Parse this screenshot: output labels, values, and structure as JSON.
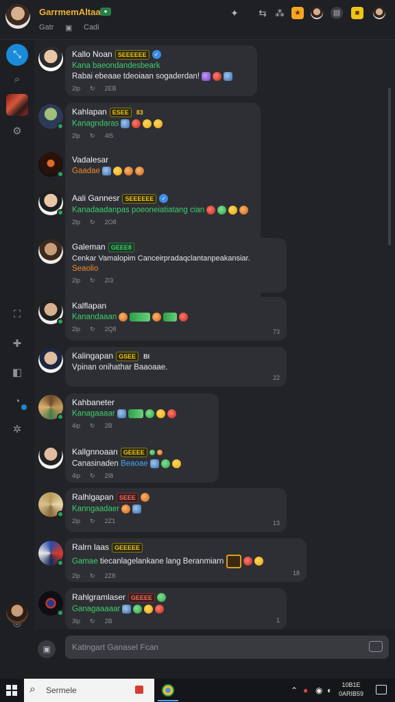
{
  "header": {
    "title": "GarrmemAltaar",
    "sub1": "Gatr",
    "sub2": "Cadi",
    "status_badge": "●"
  },
  "rail": {
    "items": [
      "direct-messages",
      "search",
      "server",
      "settings",
      "screen-share",
      "pin",
      "inbox",
      "help",
      "gear",
      "status"
    ]
  },
  "messages": [
    {
      "name": "Kallo Noan",
      "tag": "SEEEEEE",
      "lines": [
        {
          "text": "Kana baeondandesbeark",
          "color": "green"
        },
        {
          "text": "Rabai ebeaae tdeoiaan sogaderdan!",
          "color": "white"
        }
      ],
      "meta": [
        "2lp",
        "2EB"
      ],
      "stamp": ""
    },
    {
      "name": "Kahlapan",
      "tag": "ESEE",
      "tag2": "83",
      "lines": [
        {
          "text": "Kanagndaras",
          "color": "green"
        }
      ],
      "meta": [
        "2lp",
        "4I5"
      ],
      "stamp": ""
    },
    {
      "name": "Vadalesar",
      "tag": "",
      "lines": [
        {
          "text": "Gaadae",
          "color": "orange"
        }
      ],
      "meta": [],
      "stamp": ""
    },
    {
      "name": "Aali Gannesr",
      "tag": "SEEEEEE",
      "lines": [
        {
          "text": "Kanadaadanpas poeoneiatiatang cian",
          "color": "green"
        }
      ],
      "meta": [
        "2lp",
        "2O8"
      ],
      "stamp": ""
    },
    {
      "name": "Galeman",
      "tag": "GEEE8",
      "lines": [
        {
          "text": "Cenkar Vamalopim Canceirpradaqclantanpeakansiar.",
          "color": "white"
        },
        {
          "text": "Seaolio",
          "color": "orange"
        }
      ],
      "meta": [
        "2lp",
        "2I3"
      ],
      "stamp": ""
    },
    {
      "name": "Kalflapan",
      "tag": "",
      "lines": [
        {
          "text": "Kanandaaan",
          "color": "green"
        }
      ],
      "meta": [
        "2lp",
        "2Q8"
      ],
      "stamp": "73"
    },
    {
      "name": "Kalingapan",
      "tag": "GSEE",
      "tag2": "BI",
      "lines": [
        {
          "text": "Vpinan onihathar Baaoaae.",
          "color": "white"
        }
      ],
      "meta": [],
      "stamp": "22"
    },
    {
      "name": "Kahbaneter",
      "tag": "",
      "lines": [
        {
          "text": "Kanagaaaar",
          "color": "green"
        }
      ],
      "meta": [
        "4ip",
        "2B"
      ],
      "stamp": ""
    },
    {
      "name": "Kallgnnoaan",
      "tag": "GEEEE",
      "lines": [
        {
          "text": "Canasinaden",
          "color": "white"
        },
        {
          "text": "Beaoae",
          "color": "blue"
        }
      ],
      "meta": [
        "4ip",
        "2I8"
      ],
      "stamp": ""
    },
    {
      "name": "Ralhlgapan",
      "tag": "SEEE",
      "lines": [
        {
          "text": "Kanngaadaer",
          "color": "green"
        }
      ],
      "meta": [
        "2lp",
        "2Z1"
      ],
      "stamp": "13"
    },
    {
      "name": "Ralrn laas",
      "tag": "GEEEEE",
      "lines": [
        {
          "text": "Gamae",
          "color": "green"
        },
        {
          "text": "tiecanlagelankane lang Beranmiarn",
          "color": "white"
        }
      ],
      "meta": [
        "2lp",
        "2Z8"
      ],
      "stamp": "18"
    },
    {
      "name": "Rahlgramlaser",
      "tag": "GEEEE",
      "lines": [
        {
          "text": "Ganagaaaaar",
          "color": "green"
        }
      ],
      "meta": [
        "3lp",
        "2B"
      ],
      "stamp": "1"
    }
  ],
  "composer": {
    "placeholder": "Katingart Ganasel Fcan"
  },
  "taskbar": {
    "search_text": "Sermele",
    "time": "10B1E",
    "date": "0ARIB59"
  }
}
